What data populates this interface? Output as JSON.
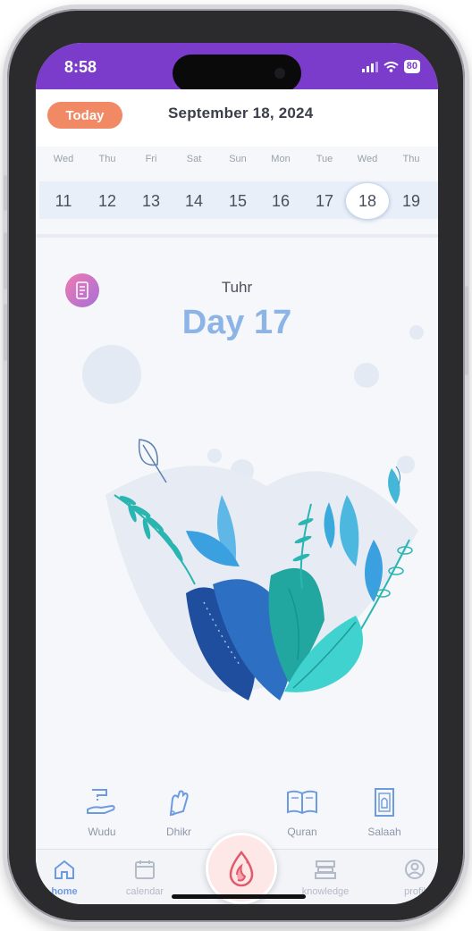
{
  "status_bar": {
    "time": "8:58",
    "battery": "80"
  },
  "header": {
    "today_label": "Today",
    "date_title": "September 18, 2024"
  },
  "calendar": {
    "weekdays": [
      "Wed",
      "Thu",
      "Fri",
      "Sat",
      "Sun",
      "Mon",
      "Tue",
      "Wed",
      "Thu"
    ],
    "days": [
      "11",
      "12",
      "13",
      "14",
      "15",
      "16",
      "17",
      "18",
      "19"
    ],
    "selected_day": "18"
  },
  "main": {
    "phase": "Tuhr",
    "day_count": "Day 17"
  },
  "actions": [
    {
      "label": "Wudu",
      "icon": "wudu-icon"
    },
    {
      "label": "Dhikr",
      "icon": "dhikr-icon"
    },
    {
      "label": "Quran",
      "icon": "quran-icon"
    },
    {
      "label": "Salaah",
      "icon": "salaah-icon"
    }
  ],
  "tabs": [
    {
      "label": "home",
      "icon": "home-icon",
      "active": true
    },
    {
      "label": "calendar",
      "icon": "calendar-icon"
    },
    {
      "label": "knowledge",
      "icon": "knowledge-icon"
    },
    {
      "label": "profil",
      "icon": "profile-icon"
    }
  ],
  "colors": {
    "status_bar": "#7b3ccb",
    "today_button": "#f08964",
    "day_count": "#8cb4e6",
    "active_tab": "#6d9be0"
  }
}
